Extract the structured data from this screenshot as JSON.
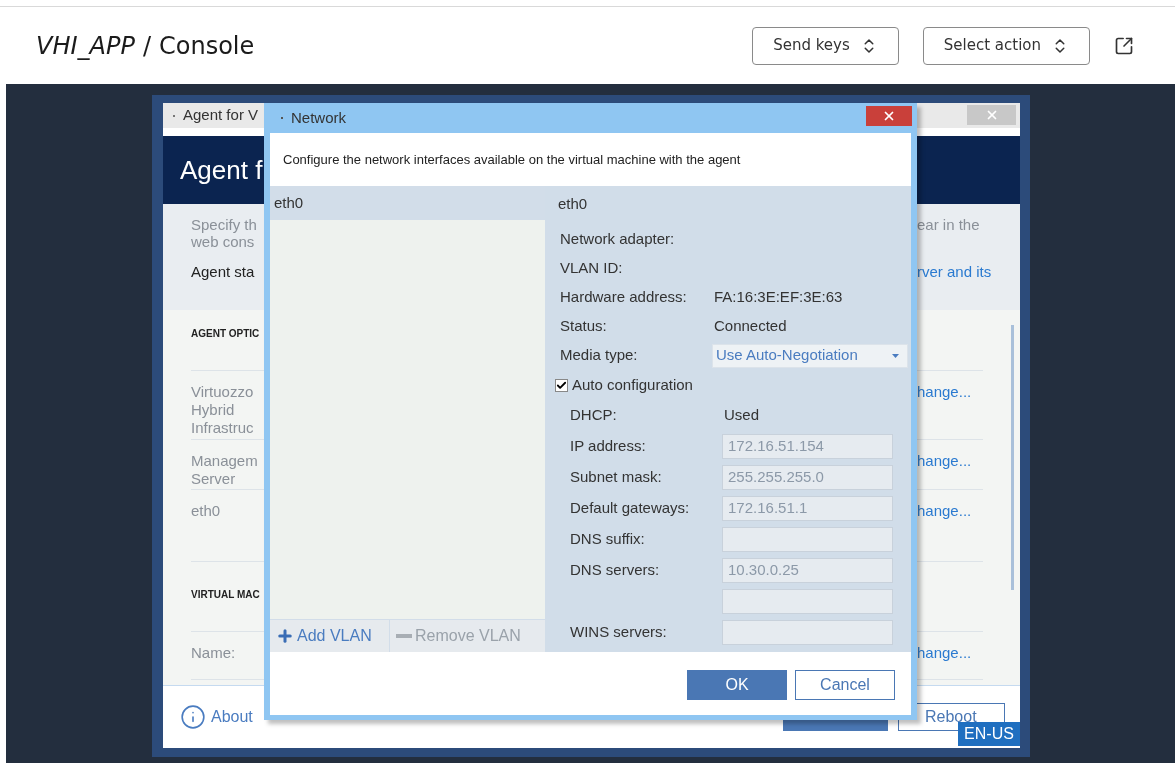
{
  "header": {
    "app_name": "VHI_APP",
    "separator": "/",
    "page_title": "Console",
    "controls": [
      {
        "label": "Send keys"
      },
      {
        "label": "Select action"
      }
    ]
  },
  "agent_window": {
    "title": "Agent for V",
    "heading": "Agent f",
    "description_lines": [
      "Specify th",
      "web cons"
    ],
    "description_tail": "ear in the",
    "status_label": "Agent sta",
    "status_link": "rver and its",
    "sections": [
      {
        "title": "AGENT OPTIC",
        "rows": [
          {
            "label_lines": [
              "Virtuozzo",
              "Hybrid",
              "Infrastruc"
            ],
            "link": "hange..."
          },
          {
            "label_lines": [
              "Managem",
              "Server"
            ],
            "link": "hange..."
          },
          {
            "label_lines": [
              "eth0"
            ],
            "link": "hange..."
          }
        ]
      },
      {
        "title": "VIRTUAL MAC",
        "rows": [
          {
            "label_lines": [
              "Name:"
            ],
            "link": "hange..."
          }
        ]
      }
    ],
    "about": "About",
    "reboot": "Reboot"
  },
  "network_dialog": {
    "title": "Network",
    "description": "Configure the network interfaces available on the virtual machine with the agent",
    "interfaces": [
      {
        "name": "eth0",
        "selected": true
      }
    ],
    "list_buttons": [
      {
        "kind": "add",
        "label": "Add VLAN"
      },
      {
        "kind": "remove",
        "label": "Remove VLAN"
      }
    ],
    "selected_interface": "eth0",
    "details": [
      {
        "kind": "text",
        "label": "Network adapter:"
      },
      {
        "kind": "text",
        "label": "VLAN ID:"
      },
      {
        "kind": "text",
        "label": "Hardware address:",
        "value": "FA:16:3E:EF:3E:63"
      },
      {
        "kind": "text",
        "label": "Status:",
        "value": "Connected"
      },
      {
        "kind": "select",
        "label": "Media type:",
        "value": "Use Auto-Negotiation"
      }
    ],
    "auto_configuration": {
      "label": "Auto configuration",
      "checked": true
    },
    "auto_fields": [
      {
        "kind": "text",
        "label": "DHCP:",
        "value": "Used"
      },
      {
        "kind": "field",
        "label": "IP address:",
        "value": "172.16.51.154"
      },
      {
        "kind": "field",
        "label": "Subnet mask:",
        "value": "255.255.255.0"
      },
      {
        "kind": "field",
        "label": "Default gateways:",
        "value": "172.16.51.1"
      },
      {
        "kind": "field",
        "label": "DNS suffix:"
      },
      {
        "kind": "field",
        "label": "DNS servers:",
        "value": "10.30.0.25"
      },
      {
        "kind": "field"
      },
      {
        "kind": "field",
        "label": "WINS servers:"
      }
    ],
    "buttons": [
      {
        "kind": "primary",
        "label": "OK"
      },
      {
        "kind": "secondary",
        "label": "Cancel"
      }
    ]
  },
  "language": "EN-US"
}
